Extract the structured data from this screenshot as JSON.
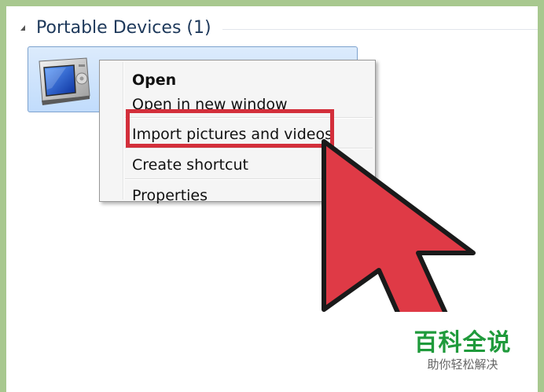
{
  "group": {
    "title": "Portable Devices (1)"
  },
  "device": {
    "icon": "portable-media-player-icon"
  },
  "context_menu": {
    "items": [
      {
        "label": "Open",
        "bold": true
      },
      {
        "label": "Open in new window",
        "bold": false
      },
      {
        "label": "Import pictures and videos",
        "bold": false,
        "highlighted": true
      },
      {
        "label": "Create shortcut",
        "bold": false
      },
      {
        "label": "Properties",
        "bold": false
      }
    ]
  },
  "annotation": {
    "highlight_color": "#d32f3b",
    "cursor_icon": "large-red-arrow-cursor-icon"
  },
  "watermark": {
    "title": "百科全说",
    "subtitle": "助你轻松解决"
  },
  "colors": {
    "frame": "#a8c88f",
    "group_title": "#1e395b",
    "selection_fill": "#c1dcfc",
    "selection_border": "#7da2ce",
    "cursor_red": "#df3a46",
    "watermark_green": "#1f9a3b"
  }
}
